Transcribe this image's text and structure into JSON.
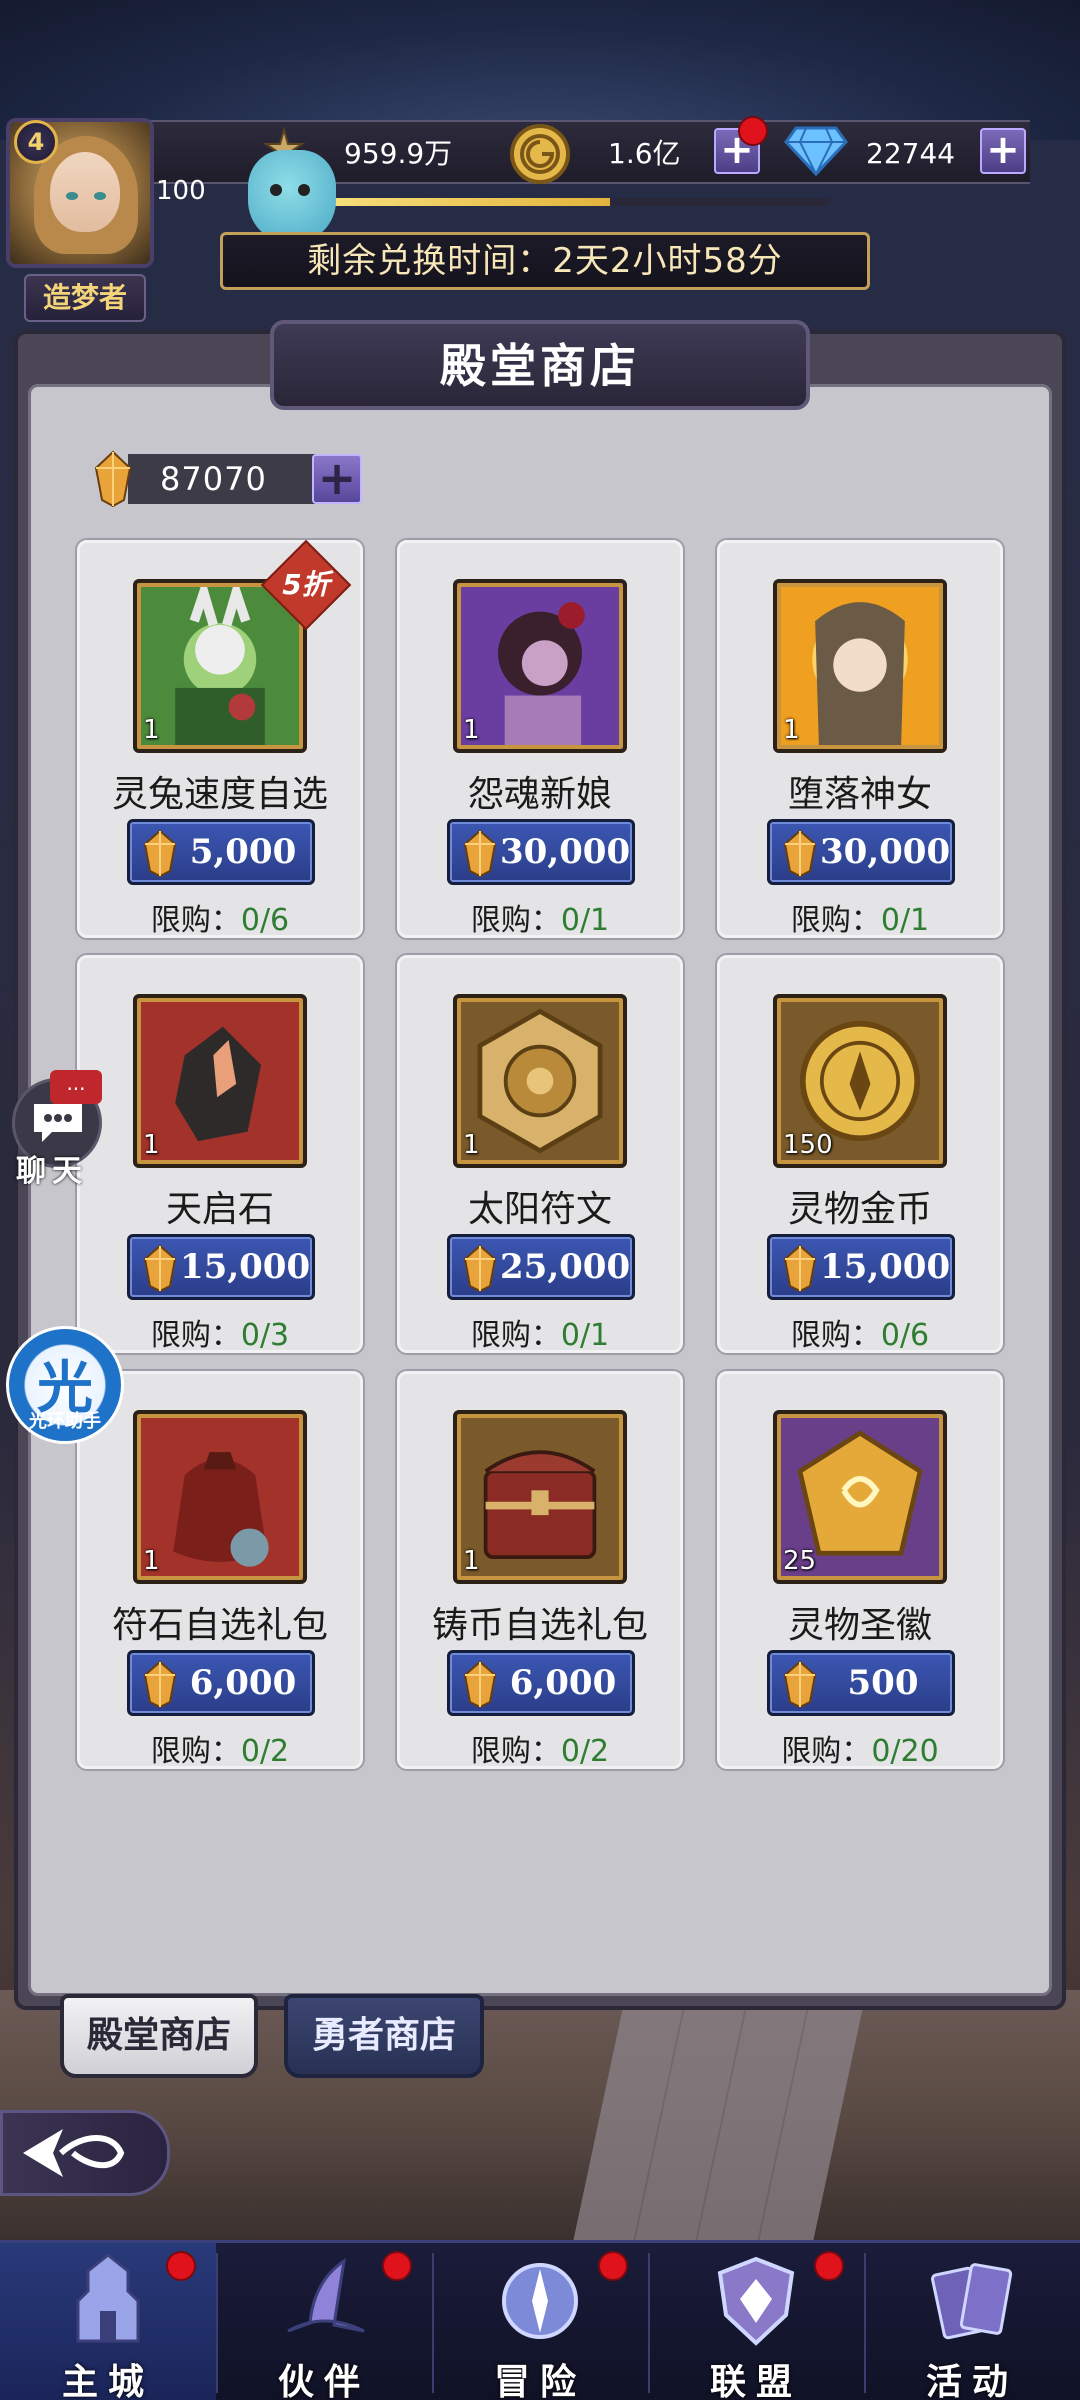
{
  "hud": {
    "level": "4",
    "avatar_level_num": "100",
    "title": "造梦者",
    "resources": [
      {
        "name": "power",
        "value": "959.9万"
      },
      {
        "name": "gold",
        "value": "1.6亿"
      },
      {
        "name": "diamond",
        "value": "22744"
      }
    ],
    "xp_fraction": 0.56,
    "timer_text": "剩余兑换时间：2天2小时58分"
  },
  "shop": {
    "title": "殿堂商店",
    "currency_value": "87070",
    "limit_label": "限购：",
    "items": [
      {
        "name": "灵兔速度自选",
        "count": "1",
        "price": "5,000",
        "limit": "0/6",
        "discount": "5折",
        "img": "rabbit-girl"
      },
      {
        "name": "怨魂新娘",
        "count": "1",
        "price": "30,000",
        "limit": "0/1",
        "discount": "",
        "img": "bride"
      },
      {
        "name": "堕落神女",
        "count": "1",
        "price": "30,000",
        "limit": "0/1",
        "discount": "",
        "img": "goddess"
      },
      {
        "name": "天启石",
        "count": "1",
        "price": "15,000",
        "limit": "0/3",
        "discount": "",
        "img": "stone"
      },
      {
        "name": "太阳符文",
        "count": "1",
        "price": "25,000",
        "limit": "0/1",
        "discount": "",
        "img": "sun-rune"
      },
      {
        "name": "灵物金币",
        "count": "150",
        "price": "15,000",
        "limit": "0/6",
        "discount": "",
        "img": "coin"
      },
      {
        "name": "符石自选礼包",
        "count": "1",
        "price": "6,000",
        "limit": "0/2",
        "discount": "",
        "img": "bag"
      },
      {
        "name": "铸币自选礼包",
        "count": "1",
        "price": "6,000",
        "limit": "0/2",
        "discount": "",
        "img": "chest"
      },
      {
        "name": "灵物圣徽",
        "count": "25",
        "price": "500",
        "limit": "0/20",
        "discount": "",
        "img": "emblem"
      }
    ]
  },
  "tabs": [
    {
      "label": "殿堂商店",
      "active": true
    },
    {
      "label": "勇者商店",
      "active": false
    }
  ],
  "side": {
    "chat_badge": "...",
    "chat_label": "聊天",
    "assist_glyph": "光",
    "assist_label": "光环助手"
  },
  "nav": [
    {
      "label": "主城",
      "icon": "castle-icon",
      "active": true,
      "dot": true
    },
    {
      "label": "伙伴",
      "icon": "wizard-hat-icon",
      "active": false,
      "dot": true
    },
    {
      "label": "冒险",
      "icon": "compass-icon",
      "active": false,
      "dot": true
    },
    {
      "label": "联盟",
      "icon": "shield-icon",
      "active": false,
      "dot": true
    },
    {
      "label": "活动",
      "icon": "cards-icon",
      "active": false,
      "dot": false
    }
  ],
  "colors": {
    "limit_value": "#2e7d32",
    "price_button": "#3c57b3",
    "panel": "#c6c6cc"
  }
}
